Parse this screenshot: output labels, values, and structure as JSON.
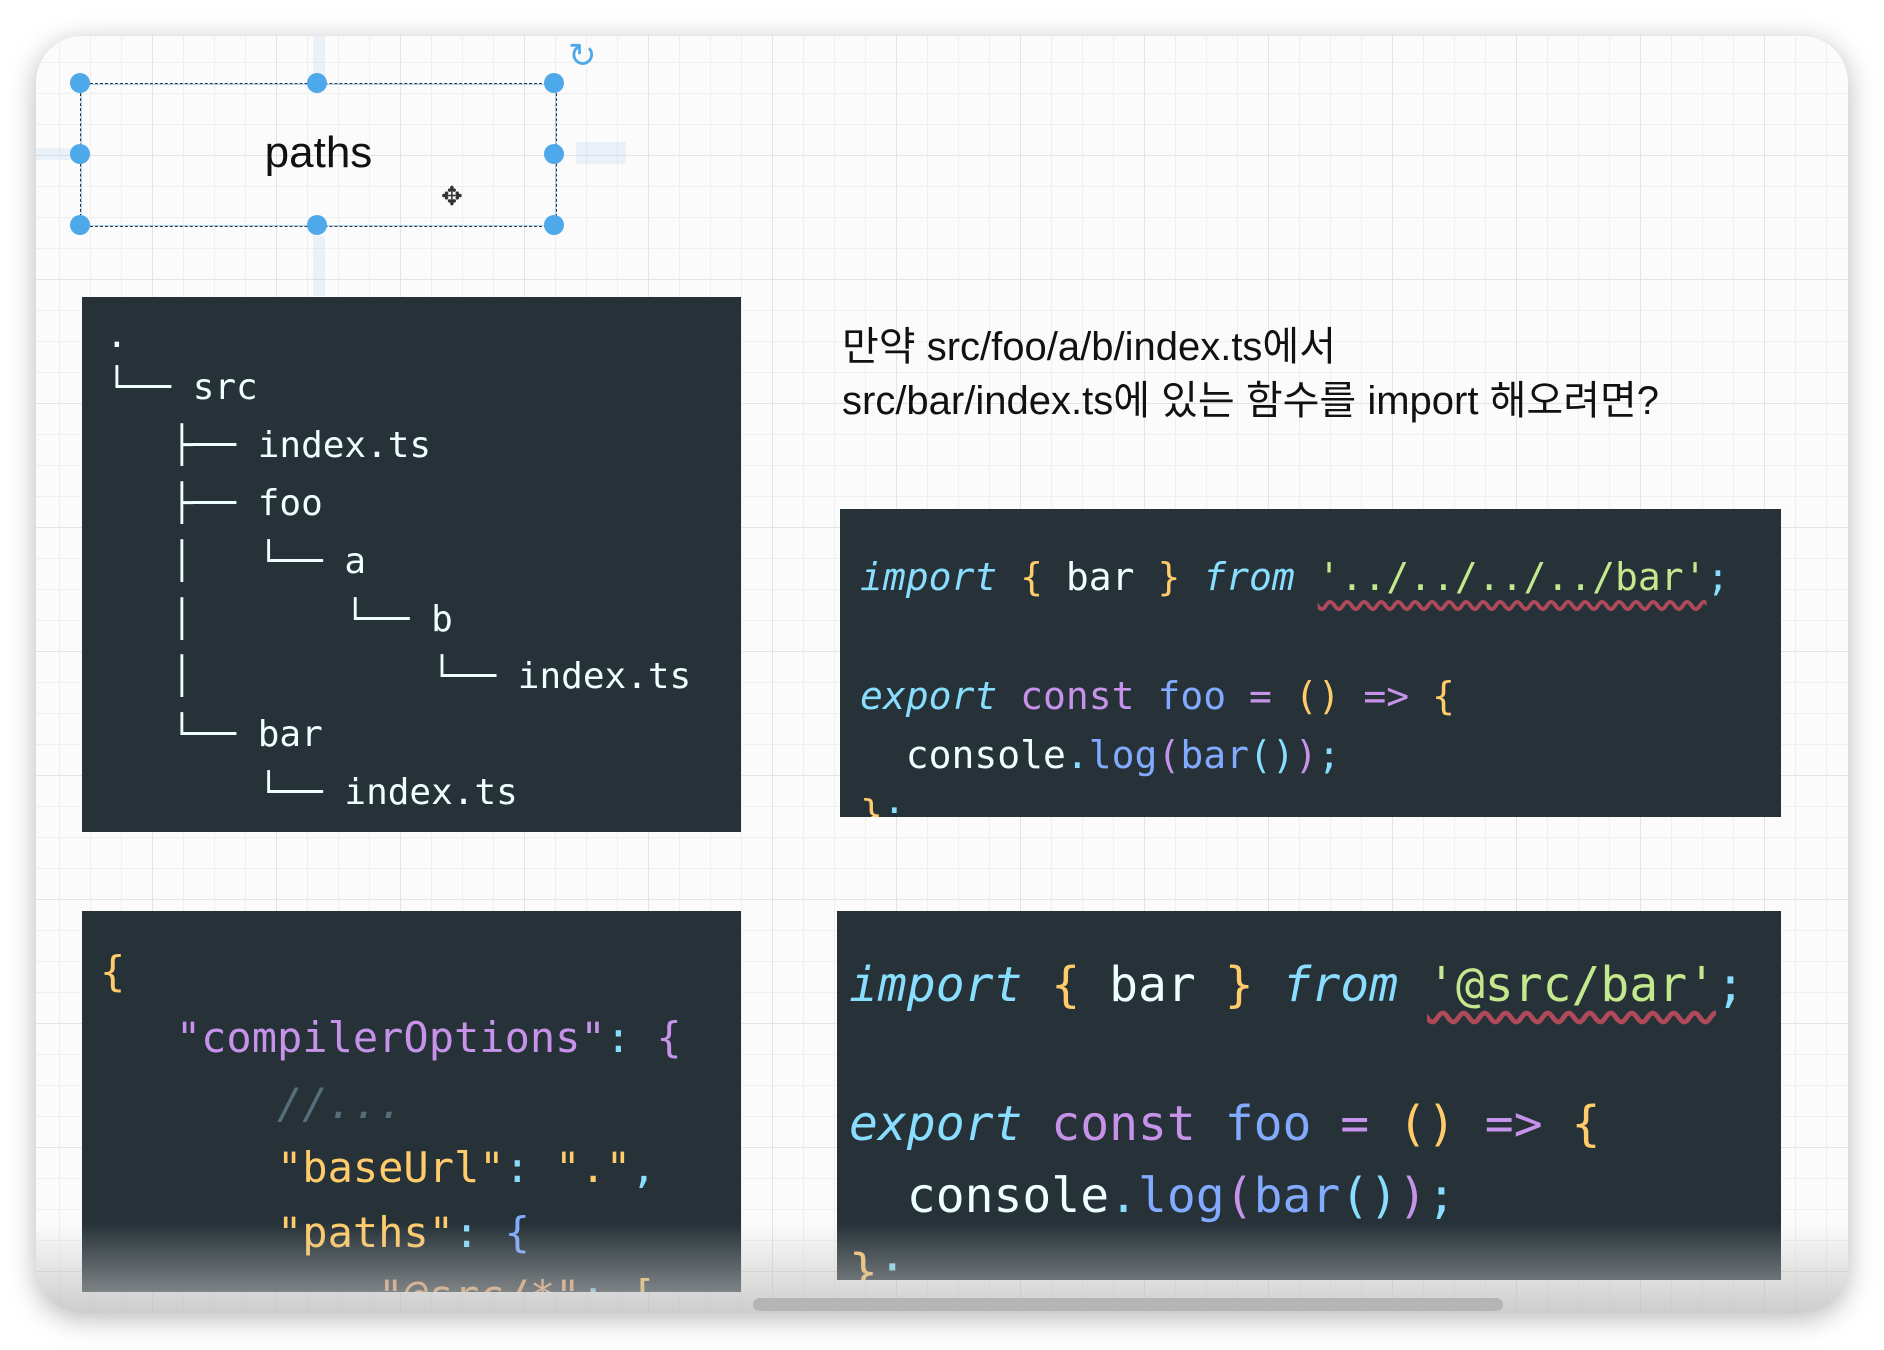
{
  "diagram_shape": {
    "label": "paths"
  },
  "question": {
    "line1": "만약 src/foo/a/b/index.ts에서",
    "line2": "src/bar/index.ts에 있는 함수를 import 해오려면?"
  },
  "tree_panel": {
    "lines": [
      ".",
      "└── src",
      "   ├── index.ts",
      "   ├── foo",
      "   │   └── a",
      "   │       └── b",
      "   │           └── index.ts",
      "   └── bar",
      "       └── index.ts"
    ]
  },
  "relative_code": {
    "lines": [
      [
        {
          "t": "import",
          "s": "kw"
        },
        {
          "t": " { ",
          "s": "yellow"
        },
        {
          "t": "bar",
          "s": "white"
        },
        {
          "t": " } ",
          "s": "yellow"
        },
        {
          "t": "from",
          "s": "kw"
        },
        {
          "t": " ",
          "s": "white"
        },
        {
          "t": "'../../../../bar'",
          "s": "str"
        },
        {
          "t": ";",
          "s": "punct"
        }
      ],
      [
        {
          "t": "export",
          "s": "kw"
        },
        {
          "t": " const ",
          "s": "purple"
        },
        {
          "t": "foo",
          "s": "blue"
        },
        {
          "t": " = ",
          "s": "purple"
        },
        {
          "t": "()",
          "s": "yellow"
        },
        {
          "t": " => ",
          "s": "purple"
        },
        {
          "t": "{",
          "s": "yellow"
        }
      ],
      [
        {
          "t": "  console",
          "s": "white"
        },
        {
          "t": ".",
          "s": "punct"
        },
        {
          "t": "log",
          "s": "blue"
        },
        {
          "t": "(",
          "s": "purple"
        },
        {
          "t": "bar",
          "s": "blue"
        },
        {
          "t": "()",
          "s": "punct"
        },
        {
          "t": ")",
          "s": "purple"
        },
        {
          "t": ";",
          "s": "punct"
        }
      ],
      [
        {
          "t": "}",
          "s": "yellow"
        },
        {
          "t": ";",
          "s": "punct"
        }
      ]
    ]
  },
  "alias_code": {
    "lines": [
      [
        {
          "t": "import",
          "s": "kw"
        },
        {
          "t": " { ",
          "s": "yellow"
        },
        {
          "t": "bar",
          "s": "white"
        },
        {
          "t": " } ",
          "s": "yellow"
        },
        {
          "t": "from",
          "s": "kw"
        },
        {
          "t": " ",
          "s": "white"
        },
        {
          "t": "'@src/bar'",
          "s": "str"
        },
        {
          "t": ";",
          "s": "punct"
        }
      ],
      [
        {
          "t": "export",
          "s": "kw"
        },
        {
          "t": " const ",
          "s": "purple"
        },
        {
          "t": "foo",
          "s": "blue"
        },
        {
          "t": " = ",
          "s": "purple"
        },
        {
          "t": "()",
          "s": "yellow"
        },
        {
          "t": " => ",
          "s": "purple"
        },
        {
          "t": "{",
          "s": "yellow"
        }
      ],
      [
        {
          "t": "  console",
          "s": "white"
        },
        {
          "t": ".",
          "s": "punct"
        },
        {
          "t": "log",
          "s": "blue"
        },
        {
          "t": "(",
          "s": "purple"
        },
        {
          "t": "bar",
          "s": "blue"
        },
        {
          "t": "()",
          "s": "punct"
        },
        {
          "t": ")",
          "s": "purple"
        },
        {
          "t": ";",
          "s": "punct"
        }
      ],
      [
        {
          "t": "}",
          "s": "yellow"
        },
        {
          "t": ";",
          "s": "punct"
        }
      ]
    ]
  },
  "tsconfig_code": {
    "lines": [
      [
        {
          "t": "{",
          "s": "yellow"
        }
      ],
      [
        {
          "t": "   \"compilerOptions\"",
          "s": "purple"
        },
        {
          "t": ": ",
          "s": "punct"
        },
        {
          "t": "{",
          "s": "purple"
        }
      ],
      [
        {
          "t": "       //...",
          "s": "comment"
        }
      ],
      [
        {
          "t": "       \"baseUrl\"",
          "s": "yellow"
        },
        {
          "t": ": ",
          "s": "punct"
        },
        {
          "t": "\".\"",
          "s": "yellow"
        },
        {
          "t": ",",
          "s": "punct"
        }
      ],
      [
        {
          "t": "       \"paths\"",
          "s": "yellow"
        },
        {
          "t": ": ",
          "s": "punct"
        },
        {
          "t": "{",
          "s": "blue"
        }
      ],
      [
        {
          "t": "           \"@src/*\"",
          "s": "orange"
        },
        {
          "t": ": ",
          "s": "punct"
        },
        {
          "t": "[",
          "s": "yellow"
        }
      ]
    ]
  }
}
